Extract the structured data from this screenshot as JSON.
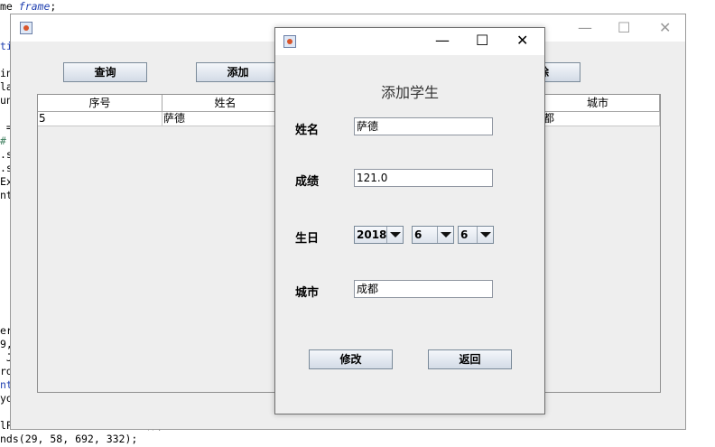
{
  "code_lines": [
    {
      "text": "me ",
      "style": ""
    },
    {
      "text": "ti",
      "style": "blue"
    },
    {
      "text": "in",
      "style": ""
    },
    {
      "text": "la",
      "style": ""
    },
    {
      "text": "un",
      "style": ""
    },
    {
      "text": " =",
      "style": ""
    },
    {
      "text": "#",
      "style": "green"
    },
    {
      "text": ".s",
      "style": ""
    },
    {
      "text": ".s",
      "style": ""
    },
    {
      "text": "Ex",
      "style": ""
    },
    {
      "text": "nt",
      "style": ""
    },
    {
      "text": "er",
      "style": ""
    },
    {
      "text": "9,",
      "style": ""
    },
    {
      "text": " J",
      "style": ""
    },
    {
      "text": "rd",
      "style": ""
    },
    {
      "text": "nt",
      "style": "blue"
    },
    {
      "text": "yo",
      "style": ""
    },
    {
      "text": "lP",
      "style": ""
    },
    {
      "text": "nds(29, 58, 692, 332);",
      "style": ""
    }
  ],
  "code_frame_word": "frame",
  "code_frame_tail": ";",
  "code_tail_fragment": "();",
  "main_window": {
    "buttons": {
      "query": "查询",
      "add": "添加",
      "delete_partial": "除"
    },
    "table": {
      "headers": [
        "序号",
        "姓名",
        "城市"
      ],
      "rows": [
        {
          "id": "5",
          "name": "萨德",
          "city": "都"
        }
      ]
    },
    "controls": {
      "minimize": "—",
      "maximize": "☐",
      "close": "✕"
    }
  },
  "dialog": {
    "heading": "添加学生",
    "controls": {
      "minimize": "—",
      "maximize": "☐",
      "close": "✕"
    },
    "fields": {
      "name_label": "姓名",
      "name_value": "萨德",
      "score_label": "成绩",
      "score_value": "121.0",
      "birthday_label": "生日",
      "year": "2018",
      "month": "6",
      "day": "6",
      "city_label": "城市",
      "city_value": "成都"
    },
    "buttons": {
      "modify": "修改",
      "back": "返回"
    }
  }
}
